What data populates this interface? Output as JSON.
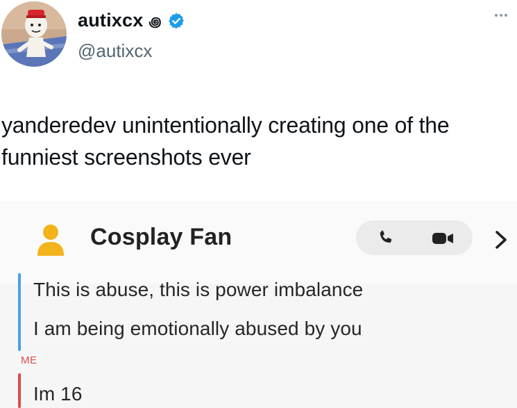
{
  "post": {
    "display_name": "autixcx",
    "name_glyph": "꩜",
    "handle": "@autixcx",
    "text": "yanderedev unintentionally creating one of the funniest screenshots ever",
    "more_icon": "more-horizontal-icon",
    "verified_icon": "verified-badge-icon"
  },
  "screenshot": {
    "contact_name": "Cosplay Fan",
    "call_icon": "phone-icon",
    "video_icon": "video-camera-icon",
    "chevron_icon": "chevron-right-icon",
    "messages_them": [
      "This is abuse, this is power imbalance",
      "I am being emotionally abused by you"
    ],
    "me_label": "ME",
    "messages_me": [
      "Im 16"
    ]
  },
  "colors": {
    "verified_blue": "#1d9bf0",
    "them_bar": "#4d9ee8",
    "me_bar": "#e24a4a",
    "bitmoji_yellow": "#f2b31b"
  }
}
